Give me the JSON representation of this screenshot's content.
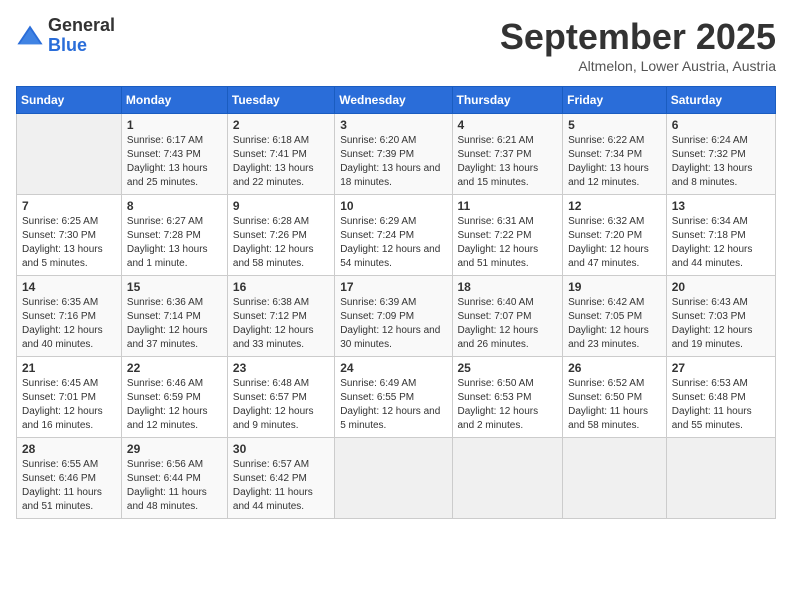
{
  "logo": {
    "general": "General",
    "blue": "Blue"
  },
  "title": "September 2025",
  "subtitle": "Altmelon, Lower Austria, Austria",
  "days_of_week": [
    "Sunday",
    "Monday",
    "Tuesday",
    "Wednesday",
    "Thursday",
    "Friday",
    "Saturday"
  ],
  "weeks": [
    [
      {
        "empty": true
      },
      {
        "day": "1",
        "sunrise": "6:17 AM",
        "sunset": "7:43 PM",
        "daylight": "13 hours and 25 minutes."
      },
      {
        "day": "2",
        "sunrise": "6:18 AM",
        "sunset": "7:41 PM",
        "daylight": "13 hours and 22 minutes."
      },
      {
        "day": "3",
        "sunrise": "6:20 AM",
        "sunset": "7:39 PM",
        "daylight": "13 hours and 18 minutes."
      },
      {
        "day": "4",
        "sunrise": "6:21 AM",
        "sunset": "7:37 PM",
        "daylight": "13 hours and 15 minutes."
      },
      {
        "day": "5",
        "sunrise": "6:22 AM",
        "sunset": "7:34 PM",
        "daylight": "13 hours and 12 minutes."
      },
      {
        "day": "6",
        "sunrise": "6:24 AM",
        "sunset": "7:32 PM",
        "daylight": "13 hours and 8 minutes."
      }
    ],
    [
      {
        "day": "7",
        "sunrise": "6:25 AM",
        "sunset": "7:30 PM",
        "daylight": "13 hours and 5 minutes."
      },
      {
        "day": "8",
        "sunrise": "6:27 AM",
        "sunset": "7:28 PM",
        "daylight": "13 hours and 1 minute."
      },
      {
        "day": "9",
        "sunrise": "6:28 AM",
        "sunset": "7:26 PM",
        "daylight": "12 hours and 58 minutes."
      },
      {
        "day": "10",
        "sunrise": "6:29 AM",
        "sunset": "7:24 PM",
        "daylight": "12 hours and 54 minutes."
      },
      {
        "day": "11",
        "sunrise": "6:31 AM",
        "sunset": "7:22 PM",
        "daylight": "12 hours and 51 minutes."
      },
      {
        "day": "12",
        "sunrise": "6:32 AM",
        "sunset": "7:20 PM",
        "daylight": "12 hours and 47 minutes."
      },
      {
        "day": "13",
        "sunrise": "6:34 AM",
        "sunset": "7:18 PM",
        "daylight": "12 hours and 44 minutes."
      }
    ],
    [
      {
        "day": "14",
        "sunrise": "6:35 AM",
        "sunset": "7:16 PM",
        "daylight": "12 hours and 40 minutes."
      },
      {
        "day": "15",
        "sunrise": "6:36 AM",
        "sunset": "7:14 PM",
        "daylight": "12 hours and 37 minutes."
      },
      {
        "day": "16",
        "sunrise": "6:38 AM",
        "sunset": "7:12 PM",
        "daylight": "12 hours and 33 minutes."
      },
      {
        "day": "17",
        "sunrise": "6:39 AM",
        "sunset": "7:09 PM",
        "daylight": "12 hours and 30 minutes."
      },
      {
        "day": "18",
        "sunrise": "6:40 AM",
        "sunset": "7:07 PM",
        "daylight": "12 hours and 26 minutes."
      },
      {
        "day": "19",
        "sunrise": "6:42 AM",
        "sunset": "7:05 PM",
        "daylight": "12 hours and 23 minutes."
      },
      {
        "day": "20",
        "sunrise": "6:43 AM",
        "sunset": "7:03 PM",
        "daylight": "12 hours and 19 minutes."
      }
    ],
    [
      {
        "day": "21",
        "sunrise": "6:45 AM",
        "sunset": "7:01 PM",
        "daylight": "12 hours and 16 minutes."
      },
      {
        "day": "22",
        "sunrise": "6:46 AM",
        "sunset": "6:59 PM",
        "daylight": "12 hours and 12 minutes."
      },
      {
        "day": "23",
        "sunrise": "6:48 AM",
        "sunset": "6:57 PM",
        "daylight": "12 hours and 9 minutes."
      },
      {
        "day": "24",
        "sunrise": "6:49 AM",
        "sunset": "6:55 PM",
        "daylight": "12 hours and 5 minutes."
      },
      {
        "day": "25",
        "sunrise": "6:50 AM",
        "sunset": "6:53 PM",
        "daylight": "12 hours and 2 minutes."
      },
      {
        "day": "26",
        "sunrise": "6:52 AM",
        "sunset": "6:50 PM",
        "daylight": "11 hours and 58 minutes."
      },
      {
        "day": "27",
        "sunrise": "6:53 AM",
        "sunset": "6:48 PM",
        "daylight": "11 hours and 55 minutes."
      }
    ],
    [
      {
        "day": "28",
        "sunrise": "6:55 AM",
        "sunset": "6:46 PM",
        "daylight": "11 hours and 51 minutes."
      },
      {
        "day": "29",
        "sunrise": "6:56 AM",
        "sunset": "6:44 PM",
        "daylight": "11 hours and 48 minutes."
      },
      {
        "day": "30",
        "sunrise": "6:57 AM",
        "sunset": "6:42 PM",
        "daylight": "11 hours and 44 minutes."
      },
      {
        "empty": true
      },
      {
        "empty": true
      },
      {
        "empty": true
      },
      {
        "empty": true
      }
    ]
  ],
  "labels": {
    "sunrise": "Sunrise:",
    "sunset": "Sunset:",
    "daylight": "Daylight:"
  }
}
